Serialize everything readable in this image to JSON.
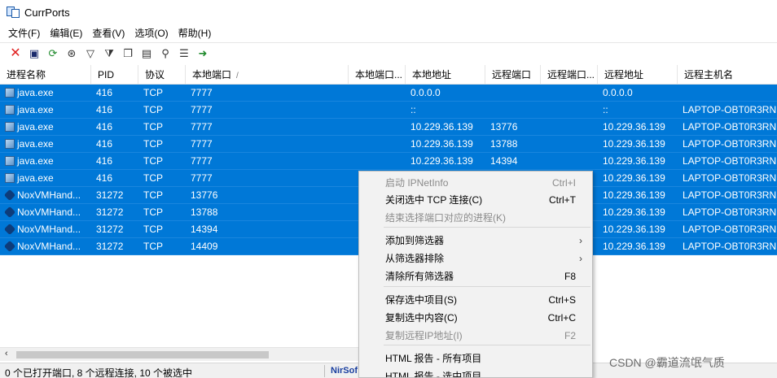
{
  "window": {
    "title": "CurrPorts"
  },
  "menubar": {
    "items": [
      "文件(F)",
      "编辑(E)",
      "查看(V)",
      "选项(O)",
      "帮助(H)"
    ]
  },
  "toolbar": {
    "icons": [
      "close-connection-icon",
      "save-icon",
      "refresh-icon",
      "options-icon",
      "filter-icon",
      "advanced-filter-icon",
      "copy-icon",
      "properties-icon",
      "find-icon",
      "html-report-icon",
      "exit-icon"
    ]
  },
  "table": {
    "columns": [
      "进程名称",
      "PID",
      "协议",
      "本地端口",
      "本地端口...",
      "本地地址",
      "远程端口",
      "远程端口...",
      "远程地址",
      "远程主机名"
    ],
    "sort_arrow": "/",
    "rows": [
      [
        "java.exe",
        "416",
        "TCP",
        "7777",
        "",
        "0.0.0.0",
        "",
        "",
        "0.0.0.0",
        ""
      ],
      [
        "java.exe",
        "416",
        "TCP",
        "7777",
        "",
        "::",
        "",
        "",
        "::",
        "LAPTOP-OBT0R3RN"
      ],
      [
        "java.exe",
        "416",
        "TCP",
        "7777",
        "",
        "10.229.36.139",
        "13776",
        "",
        "10.229.36.139",
        "LAPTOP-OBT0R3RN"
      ],
      [
        "java.exe",
        "416",
        "TCP",
        "7777",
        "",
        "10.229.36.139",
        "13788",
        "",
        "10.229.36.139",
        "LAPTOP-OBT0R3RN"
      ],
      [
        "java.exe",
        "416",
        "TCP",
        "7777",
        "",
        "10.229.36.139",
        "14394",
        "",
        "10.229.36.139",
        "LAPTOP-OBT0R3RN"
      ],
      [
        "java.exe",
        "416",
        "TCP",
        "7777",
        "",
        "",
        "",
        "",
        "10.229.36.139",
        "LAPTOP-OBT0R3RN"
      ],
      [
        "NoxVMHand...",
        "31272",
        "TCP",
        "13776",
        "",
        "",
        "",
        "",
        "10.229.36.139",
        "LAPTOP-OBT0R3RN"
      ],
      [
        "NoxVMHand...",
        "31272",
        "TCP",
        "13788",
        "",
        "",
        "",
        "",
        "10.229.36.139",
        "LAPTOP-OBT0R3RN"
      ],
      [
        "NoxVMHand...",
        "31272",
        "TCP",
        "14394",
        "",
        "",
        "",
        "",
        "10.229.36.139",
        "LAPTOP-OBT0R3RN"
      ],
      [
        "NoxVMHand...",
        "31272",
        "TCP",
        "14409",
        "",
        "",
        "",
        "",
        "10.229.36.139",
        "LAPTOP-OBT0R3RN"
      ]
    ],
    "row_icons": [
      "java",
      "java",
      "java",
      "java",
      "java",
      "java",
      "nox",
      "nox",
      "nox",
      "nox"
    ]
  },
  "context_menu": {
    "items": [
      {
        "label": "启动 IPNetInfo",
        "shortcut": "Ctrl+I",
        "disabled": true
      },
      {
        "label": "关闭选中 TCP 连接(C)",
        "shortcut": "Ctrl+T",
        "disabled": false
      },
      {
        "label": "结束选择端口对应的进程(K)",
        "shortcut": "",
        "disabled": true
      },
      {
        "label": "添加到筛选器",
        "shortcut": "",
        "submenu": true
      },
      {
        "label": "从筛选器排除",
        "shortcut": "",
        "submenu": true
      },
      {
        "label": "清除所有筛选器",
        "shortcut": "F8",
        "disabled": false
      },
      {
        "label": "保存选中项目(S)",
        "shortcut": "Ctrl+S",
        "disabled": false
      },
      {
        "label": "复制选中内容(C)",
        "shortcut": "Ctrl+C",
        "disabled": false
      },
      {
        "label": "复制远程IP地址(I)",
        "shortcut": "F2",
        "disabled": true
      },
      {
        "label": "HTML 报告 - 所有项目",
        "shortcut": "",
        "disabled": false
      },
      {
        "label": "HTML 报告 - 选中项目",
        "shortcut": "",
        "disabled": false
      }
    ],
    "submenu_arrow": "›"
  },
  "scrollbar": {
    "left_arrow": "‹"
  },
  "status": {
    "text": "0 个已打开端口, 8 个远程连接, 10 个被选中",
    "link": "NirSof"
  },
  "watermark": "CSDN @霸道流氓气质",
  "colors": {
    "selection": "#0078d7",
    "menu_bg": "#f2f2f2",
    "disabled_text": "#8a8a8a"
  }
}
